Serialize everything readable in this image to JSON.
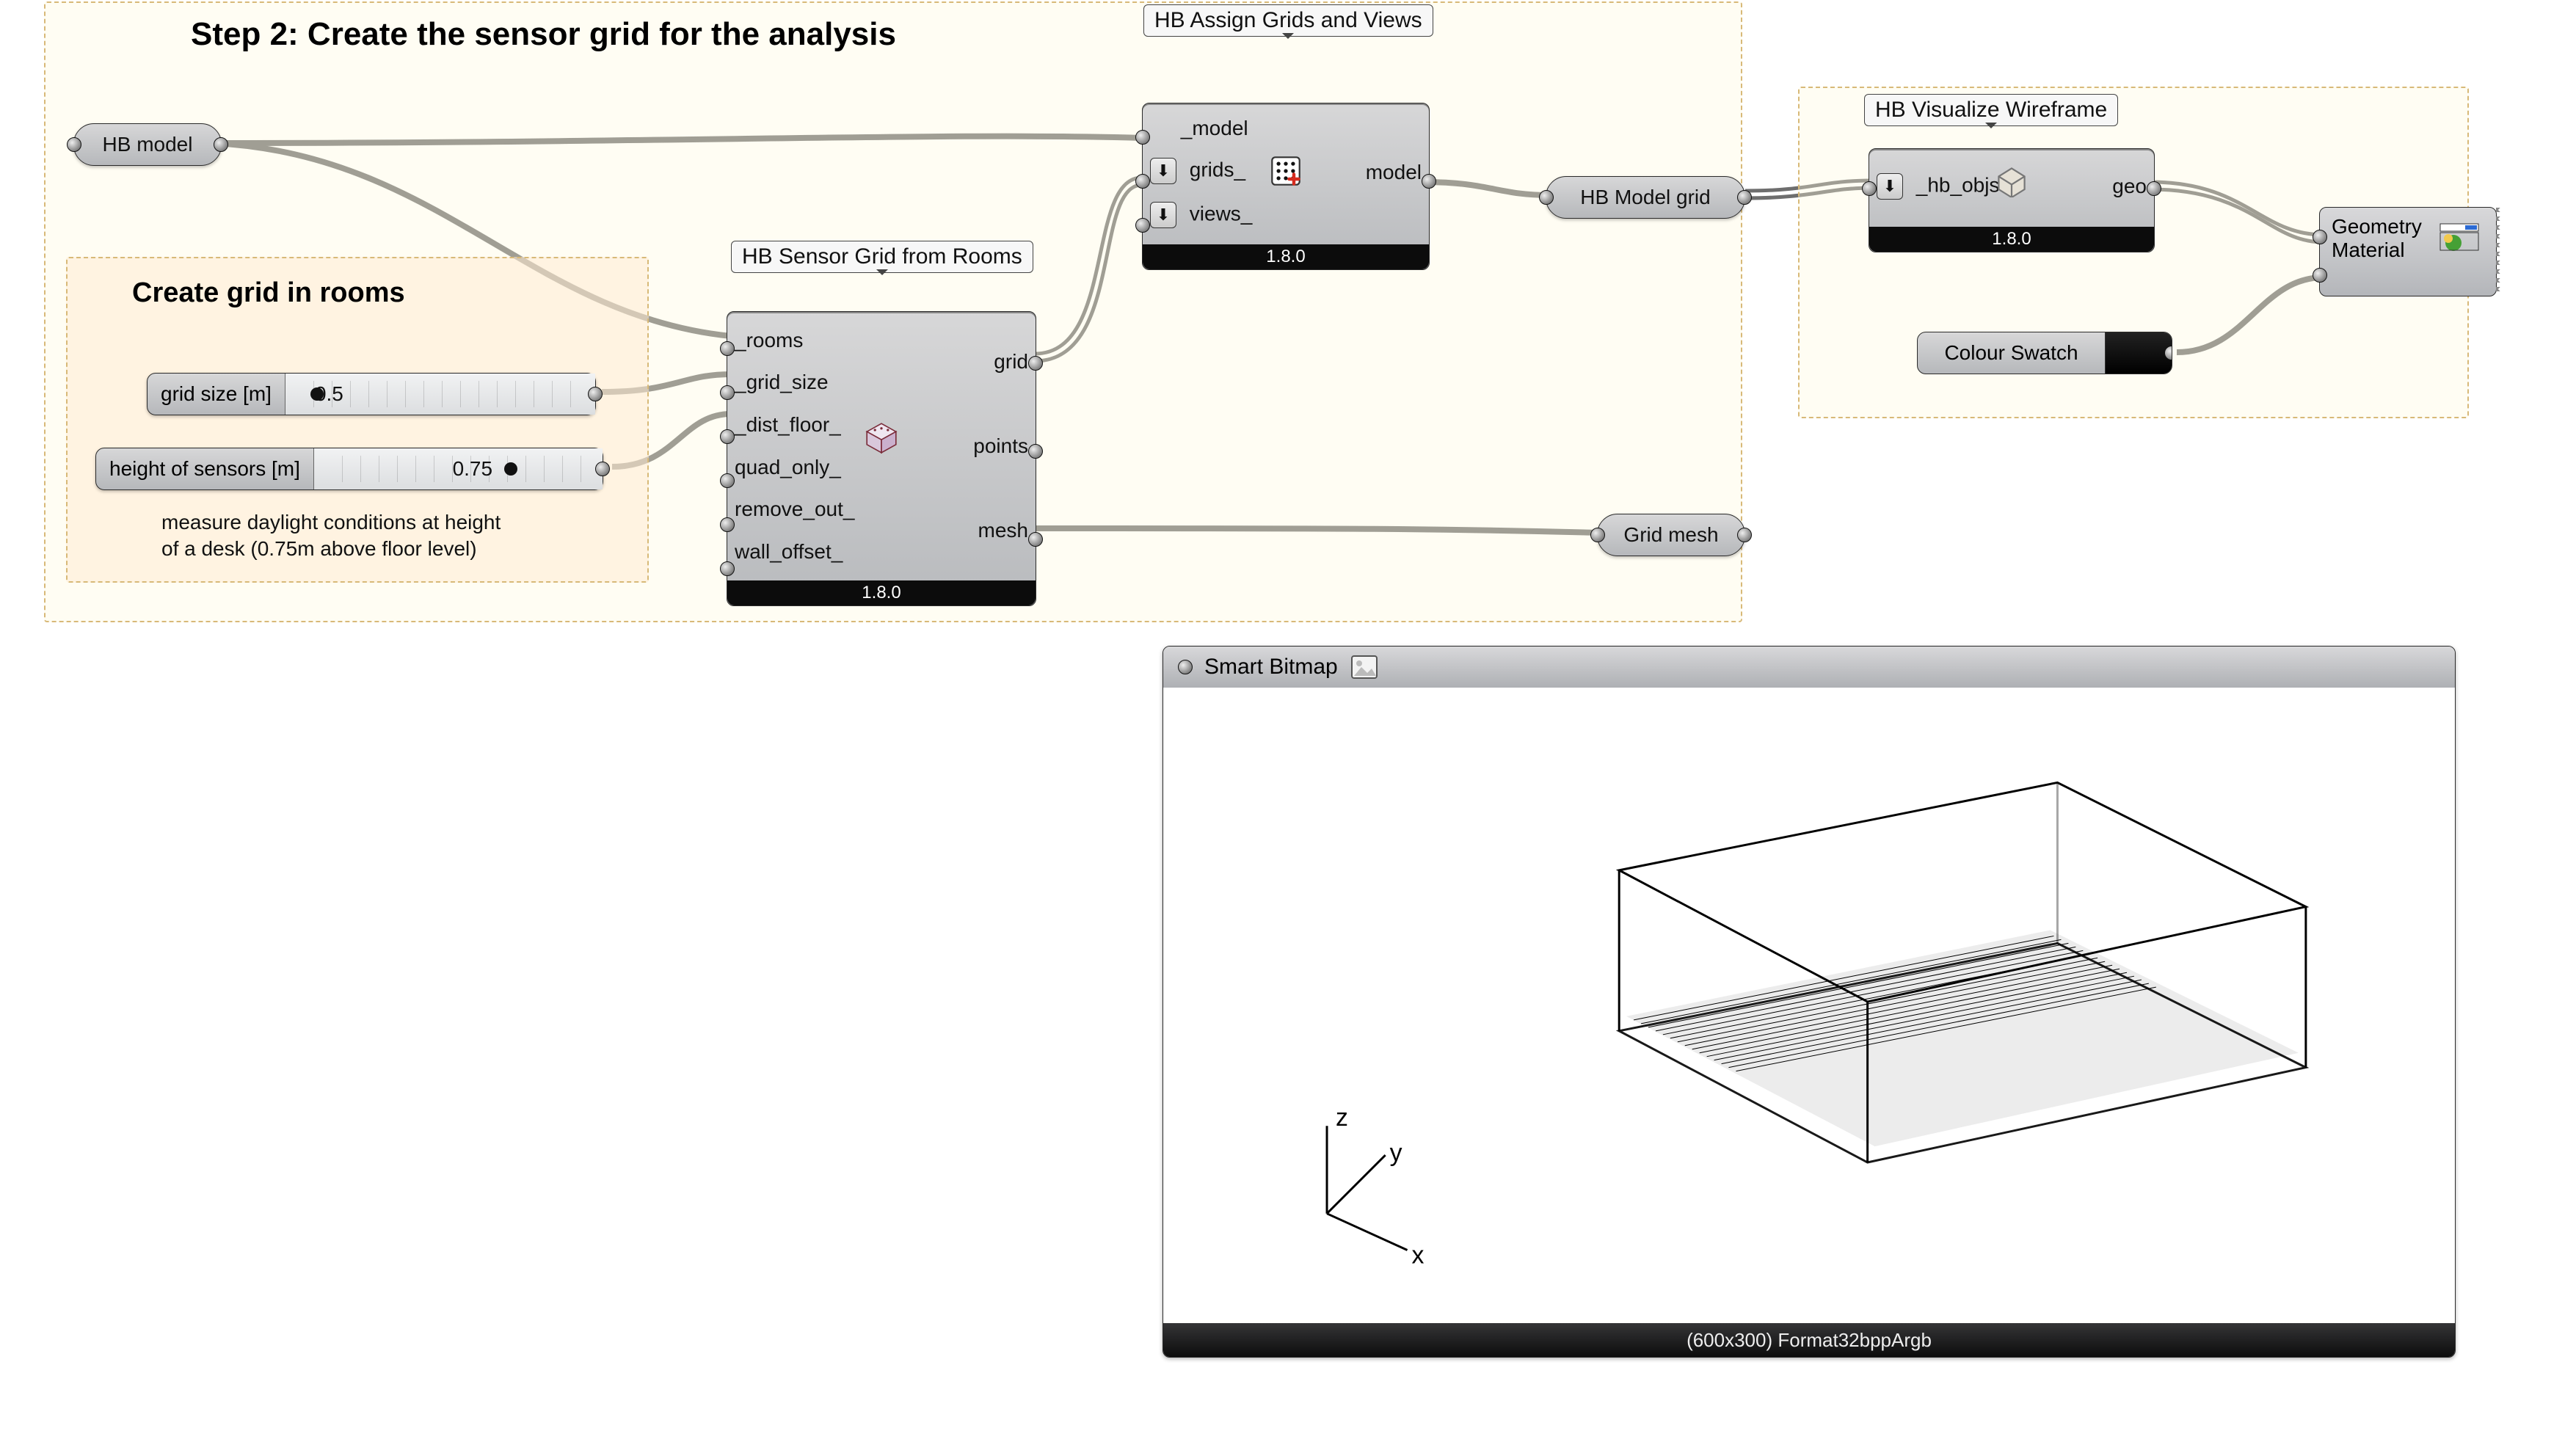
{
  "step_title": "Step 2: Create the sensor grid for the analysis",
  "inner_group_title": "Create grid in rooms",
  "hb_model_param": {
    "label": "HB model"
  },
  "sensor_grid": {
    "title": "HB Sensor Grid from Rooms",
    "version": "1.8.0",
    "inputs": [
      "_rooms",
      "_grid_size",
      "_dist_floor_",
      "quad_only_",
      "remove_out_",
      "wall_offset_"
    ],
    "outputs": [
      "grid",
      "points",
      "mesh"
    ]
  },
  "assign_grids": {
    "title": "HB Assign Grids and Views",
    "version": "1.8.0",
    "inputs": [
      "_model",
      "grids_",
      "views_"
    ],
    "outputs": [
      "model"
    ]
  },
  "viz_wireframe": {
    "title": "HB Visualize Wireframe",
    "version": "1.8.0",
    "inputs": [
      "_hb_objs"
    ],
    "outputs": [
      "geo"
    ]
  },
  "hb_model_grid_param": {
    "label": "HB Model grid"
  },
  "grid_mesh_param": {
    "label": "Grid mesh"
  },
  "preview_component": {
    "inputs": [
      "Geometry",
      "Material"
    ]
  },
  "colour_swatch": {
    "label": "Colour Swatch",
    "value_hex": "#000000"
  },
  "slider_grid_size": {
    "label": "grid size [m]",
    "value": "0.5",
    "knob_frac": 0.06
  },
  "slider_sensor_height": {
    "label": "height of sensors [m]",
    "value": "0.75",
    "knob_frac": 0.62
  },
  "sensor_height_note_line1": "measure daylight conditions at height",
  "sensor_height_note_line2": "of a desk (0.75m above floor level)",
  "bitmap_panel": {
    "title": "Smart Bitmap",
    "footer": "(600x300) Format32bppArgb",
    "axis_labels": {
      "x": "x",
      "y": "y",
      "z": "z"
    }
  },
  "glyphs": {
    "list_arrow": "⬇"
  },
  "colors": {
    "group_border": "#d8b978",
    "wire": "#6e6e6e",
    "wire_double": "#6e6e6e"
  }
}
